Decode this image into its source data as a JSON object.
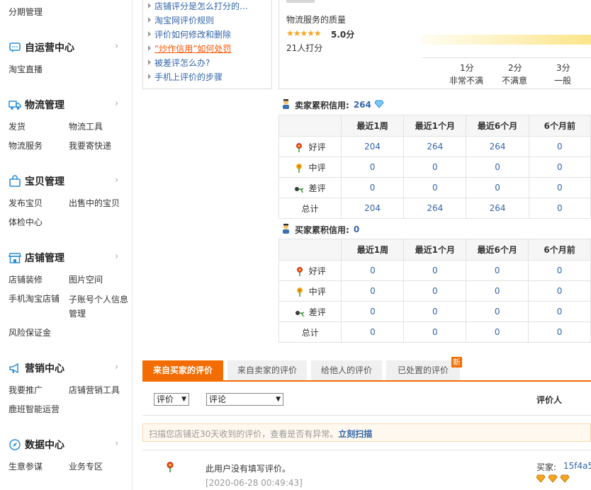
{
  "sidebar": {
    "top_link": "分期管理",
    "sections": [
      {
        "title": "自运营中心",
        "icon": "chat-bubble-icon",
        "links": [
          "淘宝直播"
        ]
      },
      {
        "title": "物流管理",
        "icon": "truck-icon",
        "links": [
          "发货",
          "物流工具",
          "物流服务",
          "我要寄快递"
        ]
      },
      {
        "title": "宝贝管理",
        "icon": "bag-icon",
        "links": [
          "发布宝贝",
          "出售中的宝贝",
          "体检中心"
        ]
      },
      {
        "title": "店铺管理",
        "icon": "store-icon",
        "links": [
          "店铺装修",
          "图片空间",
          "手机淘宝店铺",
          "子账号个人信息管理",
          "风险保证金"
        ]
      },
      {
        "title": "营销中心",
        "icon": "megaphone-icon",
        "links": [
          "我要推广",
          "店铺营销工具",
          "鹿班智能运营"
        ]
      },
      {
        "title": "数据中心",
        "icon": "compass-icon",
        "links": [
          "生意参谋",
          "业务专区"
        ]
      }
    ]
  },
  "help": {
    "items": [
      "店铺评分是怎么打分的…",
      "淘宝网评价规则",
      "评价如何修改和删除",
      "“炒作信用”如何处罚",
      "被差评怎么办?",
      "手机上评价的步骤"
    ]
  },
  "rating": {
    "label": "物流服务的质量",
    "stars": "★★★★★",
    "score": "5.0分",
    "count": "21人打分",
    "scale": [
      {
        "score": "1分",
        "desc": "非常不满"
      },
      {
        "score": "2分",
        "desc": "不满意"
      },
      {
        "score": "3分",
        "desc": "一般"
      }
    ]
  },
  "seller_credit": {
    "title": "卖家累积信用:",
    "score": "264",
    "headers": [
      "",
      "最近1周",
      "最近1个月",
      "最近6个月",
      "6个月前"
    ],
    "rows": [
      {
        "label": "好评",
        "icon": "red-flower-icon",
        "values": [
          "204",
          "264",
          "264",
          "0"
        ]
      },
      {
        "label": "中评",
        "icon": "yellow-flower-icon",
        "values": [
          "0",
          "0",
          "0",
          "0"
        ]
      },
      {
        "label": "差评",
        "icon": "wilted-flower-icon",
        "values": [
          "0",
          "0",
          "0",
          "0"
        ]
      },
      {
        "label": "总计",
        "icon": "",
        "values": [
          "204",
          "264",
          "264",
          "0"
        ]
      }
    ]
  },
  "buyer_credit": {
    "title": "买家累积信用:",
    "score": "0",
    "headers": [
      "",
      "最近1周",
      "最近1个月",
      "最近6个月",
      "6个月前"
    ],
    "rows": [
      {
        "label": "好评",
        "icon": "red-flower-icon",
        "values": [
          "0",
          "0",
          "0",
          "0"
        ]
      },
      {
        "label": "中评",
        "icon": "yellow-flower-icon",
        "values": [
          "0",
          "0",
          "0",
          "0"
        ]
      },
      {
        "label": "差评",
        "icon": "wilted-flower-icon",
        "values": [
          "0",
          "0",
          "0",
          "0"
        ]
      },
      {
        "label": "总计",
        "icon": "",
        "values": [
          "0",
          "0",
          "0",
          "0"
        ]
      }
    ]
  },
  "tabs": {
    "items": [
      "来自买家的评价",
      "来自卖家的评价",
      "给他人的评价",
      "已处置的评价"
    ],
    "new_badge": "新"
  },
  "filters": {
    "rating_select": "评价",
    "comment_select": "评论",
    "reviewer_header": "评价人"
  },
  "notice": {
    "text": "扫描您店铺近30天收到的评价，查看是否有异常。",
    "link": "立刻扫描"
  },
  "review": {
    "text": "此用户没有填写评价。",
    "time": "[2020-06-28 00:49:43]",
    "buyer_label": "买家:",
    "buyer_id": "15f4a5"
  },
  "colors": {
    "accent": "#f26c00",
    "link": "#3366aa",
    "sidebar_icon": "#2c8ed8"
  }
}
